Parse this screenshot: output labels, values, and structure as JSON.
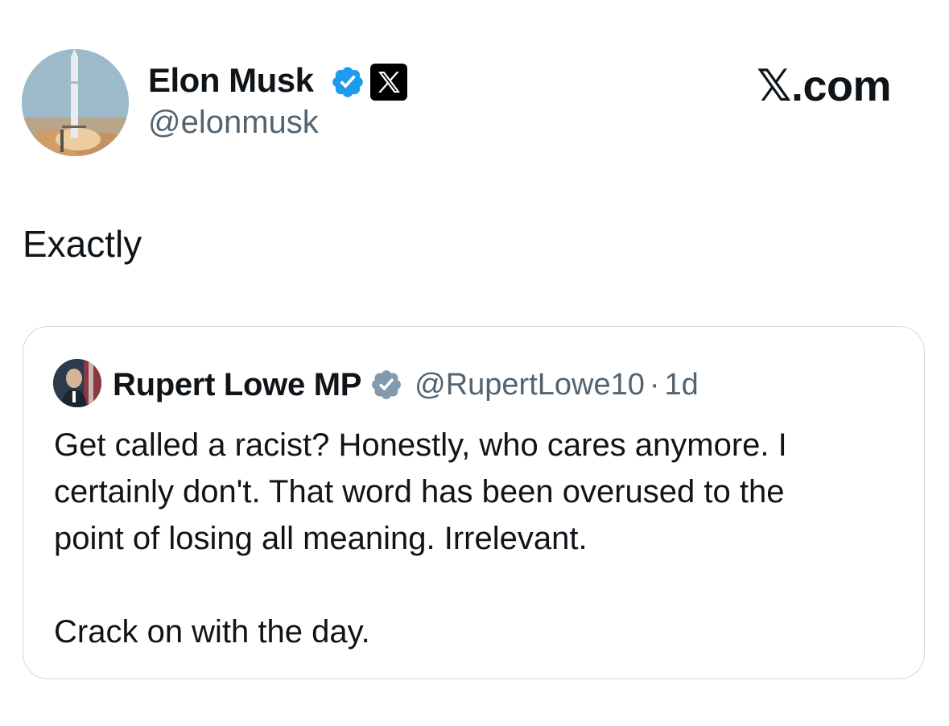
{
  "author": {
    "name": "Elon Musk",
    "handle": "@elonmusk"
  },
  "brand": {
    "x_glyph": "𝕏",
    "suffix": ".com"
  },
  "tweet": {
    "text": "Exactly"
  },
  "quoted": {
    "name": "Rupert Lowe MP",
    "handle": "@RupertLowe10",
    "separator": "·",
    "time": "1d",
    "body_lines": [
      "Get called a racist? Honestly, who cares anymore. I",
      "certainly don't. That word has been overused to the",
      "point of losing all meaning. Irrelevant."
    ],
    "body_last": "Crack on with the day."
  },
  "colors": {
    "verified_blue": "#1d9bf0",
    "verified_gray": "#829aab",
    "text": "#0f1419",
    "muted": "#536471",
    "border": "#cfd9de"
  },
  "icons": {
    "verified_main": "verified-badge-icon",
    "affiliate": "x-logo-icon",
    "verified_quoted": "verified-badge-icon"
  }
}
